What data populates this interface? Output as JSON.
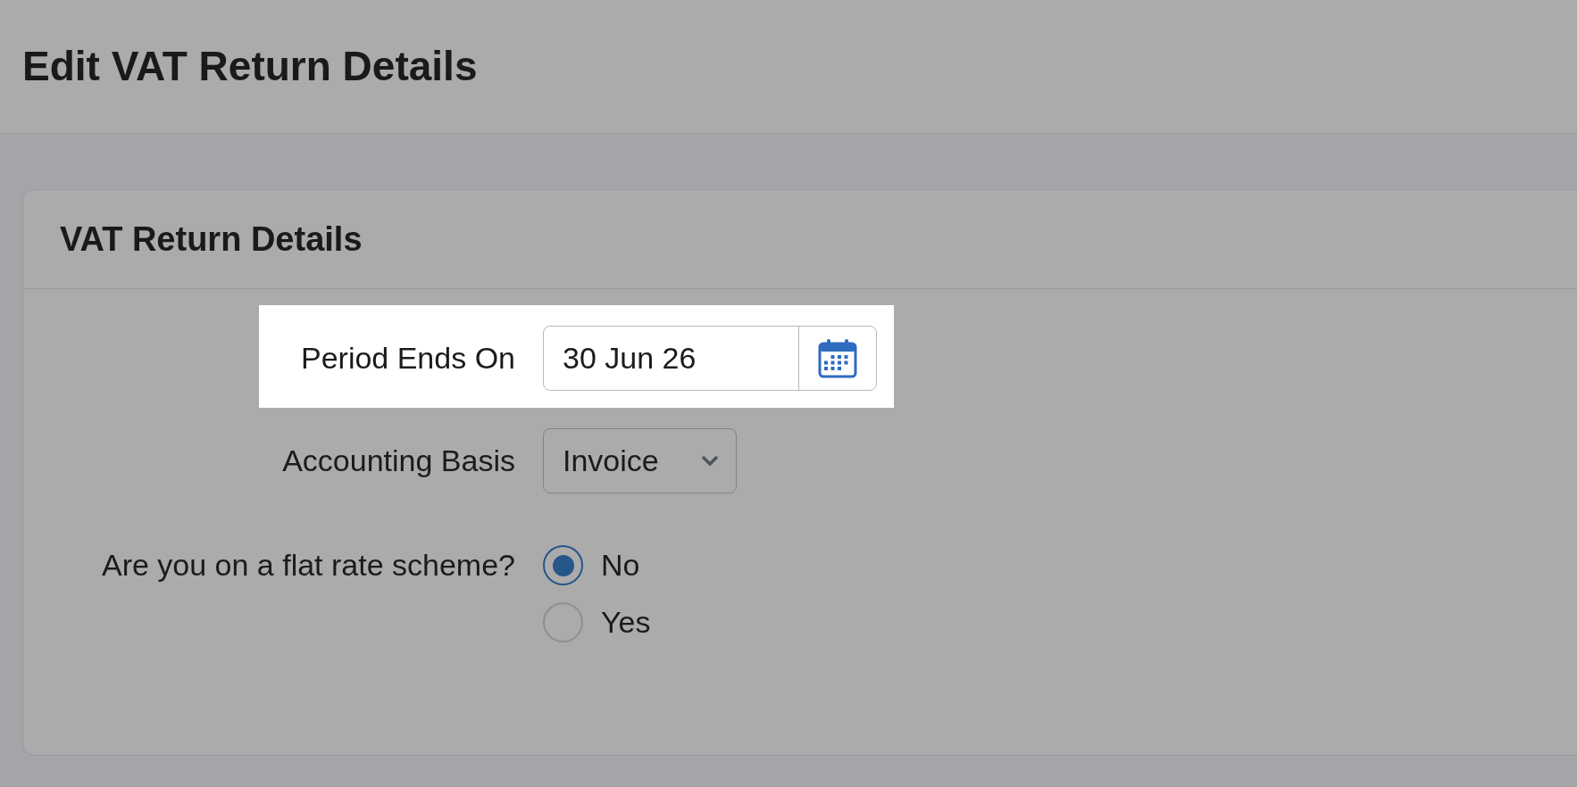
{
  "header": {
    "title": "Edit VAT Return Details"
  },
  "card": {
    "title": "VAT Return Details",
    "fields": [
      {
        "kind": "date",
        "label": "Period Ends On",
        "value": "30 Jun 26",
        "highlighted": true
      },
      {
        "kind": "select",
        "label": "Accounting Basis",
        "value": "Invoice",
        "highlighted": false
      },
      {
        "kind": "radio",
        "label": "Are you on a flat rate scheme?",
        "highlighted": false,
        "options": [
          {
            "label": "No",
            "selected": true
          },
          {
            "label": "Yes",
            "selected": false
          }
        ]
      }
    ]
  }
}
